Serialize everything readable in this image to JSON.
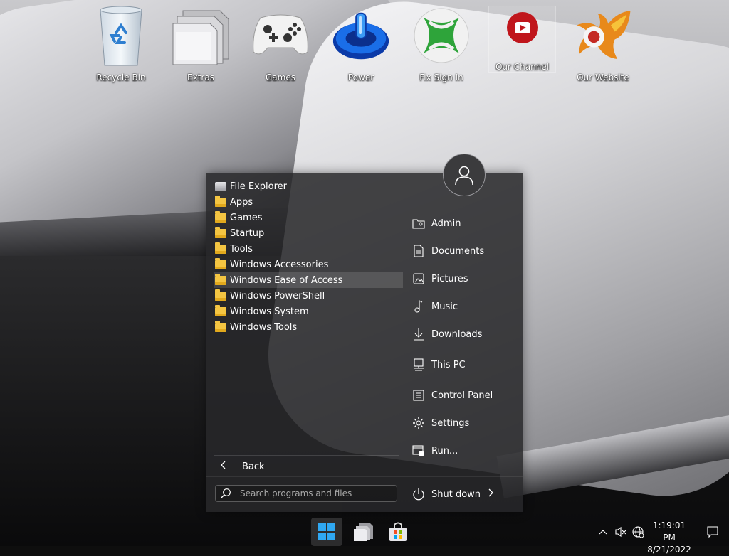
{
  "desktop": {
    "icons": [
      {
        "label": "Recycle Bin",
        "icon": "recycle-bin-icon"
      },
      {
        "label": "Extras",
        "icon": "folder-stack-icon"
      },
      {
        "label": "Games",
        "icon": "gamepad-icon"
      },
      {
        "label": "Power",
        "icon": "power-icon"
      },
      {
        "label": "Fix Sign In",
        "icon": "xbox-icon"
      },
      {
        "label": "Our Channel",
        "icon": "youtube-icon"
      },
      {
        "label": "Our Website",
        "icon": "phoenix-logo-icon"
      }
    ]
  },
  "start_menu": {
    "programs": [
      {
        "label": "File Explorer",
        "icon": "file-explorer-icon"
      },
      {
        "label": "Apps",
        "icon": "folder-icon"
      },
      {
        "label": "Games",
        "icon": "folder-icon"
      },
      {
        "label": "Startup",
        "icon": "folder-icon"
      },
      {
        "label": "Tools",
        "icon": "folder-icon"
      },
      {
        "label": "Windows Accessories",
        "icon": "folder-icon"
      },
      {
        "label": "Windows Ease of Access",
        "icon": "folder-icon"
      },
      {
        "label": "Windows PowerShell",
        "icon": "folder-icon"
      },
      {
        "label": "Windows System",
        "icon": "folder-icon"
      },
      {
        "label": "Windows Tools",
        "icon": "folder-icon"
      }
    ],
    "back_label": "Back",
    "search": {
      "placeholder": "Search programs and files"
    },
    "places": [
      {
        "label": "Admin",
        "icon": "user-folder-icon"
      },
      {
        "label": "Documents",
        "icon": "document-icon"
      },
      {
        "label": "Pictures",
        "icon": "picture-icon"
      },
      {
        "label": "Music",
        "icon": "music-note-icon"
      },
      {
        "label": "Downloads",
        "icon": "download-icon"
      },
      {
        "label": "This PC",
        "icon": "computer-icon"
      },
      {
        "label": "Control Panel",
        "icon": "control-panel-icon"
      },
      {
        "label": "Settings",
        "icon": "gear-icon"
      },
      {
        "label": "Run...",
        "icon": "run-icon"
      }
    ],
    "shutdown_label": "Shut down"
  },
  "taskbar": {
    "time": "1:19:01 PM",
    "date": "8/21/2022"
  }
}
